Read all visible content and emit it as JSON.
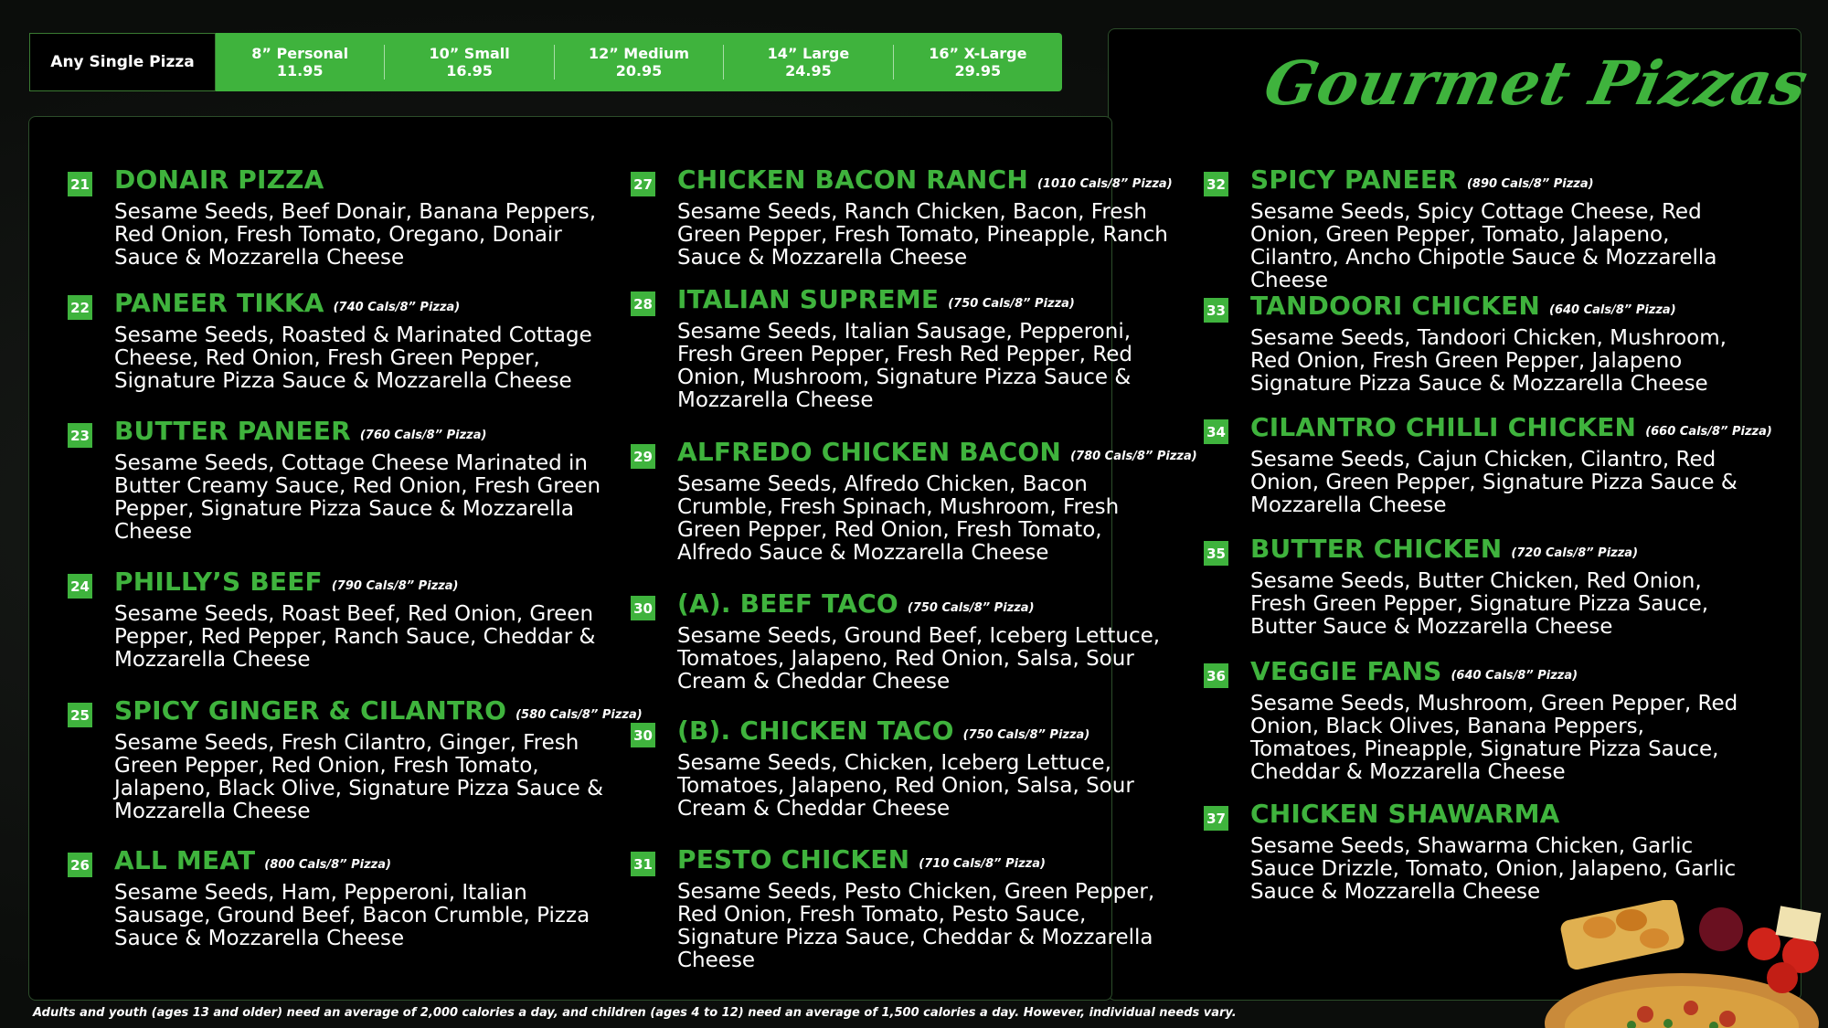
{
  "price_bar": {
    "label": "Any Single Pizza",
    "sizes": [
      {
        "name": "8” Personal",
        "price": "11.95"
      },
      {
        "name": "10” Small",
        "price": "16.95"
      },
      {
        "name": "12” Medium",
        "price": "20.95"
      },
      {
        "name": "14” Large",
        "price": "24.95"
      },
      {
        "name": "16” X-Large",
        "price": "29.95"
      }
    ]
  },
  "title": "Gourmet Pizzas",
  "items": [
    {
      "num": "21",
      "name": "DONAIR PIZZA",
      "cals": "",
      "desc": "Sesame Seeds, Beef Donair, Banana Peppers, Red Onion, Fresh Tomato, Oregano, Donair Sauce & Mozzarella Cheese"
    },
    {
      "num": "22",
      "name": "PANEER TIKKA",
      "cals": "(740 Cals/8” Pizza)",
      "desc": "Sesame Seeds, Roasted & Marinated Cottage Cheese, Red Onion, Fresh Green Pepper, Signature Pizza Sauce & Mozzarella Cheese"
    },
    {
      "num": "23",
      "name": "BUTTER PANEER",
      "cals": "(760 Cals/8” Pizza)",
      "desc": "Sesame Seeds, Cottage Cheese Marinated in Butter Creamy Sauce, Red Onion, Fresh Green Pepper, Signature Pizza Sauce & Mozzarella Cheese"
    },
    {
      "num": "24",
      "name": "PHILLY’S BEEF",
      "cals": "(790 Cals/8” Pizza)",
      "desc": "Sesame Seeds, Roast Beef, Red Onion, Green Pepper, Red Pepper, Ranch Sauce, Cheddar & Mozzarella Cheese"
    },
    {
      "num": "25",
      "name": "SPICY GINGER & CILANTRO",
      "cals": "(580 Cals/8” Pizza)",
      "desc": "Sesame Seeds, Fresh Cilantro, Ginger, Fresh Green Pepper, Red Onion, Fresh Tomato, Jalapeno, Black Olive, Signature Pizza Sauce & Mozzarella Cheese"
    },
    {
      "num": "26",
      "name": "ALL MEAT",
      "cals": "(800 Cals/8” Pizza)",
      "desc": "Sesame Seeds, Ham, Pepperoni, Italian Sausage, Ground Beef, Bacon Crumble, Pizza Sauce & Mozzarella Cheese"
    },
    {
      "num": "27",
      "name": "CHICKEN BACON RANCH",
      "cals": "(1010 Cals/8” Pizza)",
      "desc": "Sesame Seeds, Ranch Chicken, Bacon, Fresh Green Pepper, Fresh Tomato, Pineapple, Ranch Sauce & Mozzarella Cheese"
    },
    {
      "num": "28",
      "name": "ITALIAN SUPREME",
      "cals": "(750 Cals/8” Pizza)",
      "desc": "Sesame Seeds, Italian Sausage, Pepperoni, Fresh Green Pepper, Fresh Red Pepper, Red Onion, Mushroom, Signature Pizza Sauce & Mozzarella Cheese"
    },
    {
      "num": "29",
      "name": "ALFREDO CHICKEN BACON",
      "cals": "(780 Cals/8” Pizza)",
      "desc": "Sesame Seeds, Alfredo Chicken, Bacon Crumble, Fresh Spinach, Mushroom, Fresh Green Pepper, Red Onion, Fresh Tomato, Alfredo Sauce & Mozzarella Cheese"
    },
    {
      "num": "30",
      "name": "(A). BEEF TACO",
      "cals": "(750 Cals/8” Pizza)",
      "desc": "Sesame Seeds, Ground Beef, Iceberg Lettuce, Tomatoes, Jalapeno, Red Onion, Salsa, Sour Cream & Cheddar Cheese"
    },
    {
      "num": "30",
      "name": "(B). CHICKEN TACO",
      "cals": "(750 Cals/8” Pizza)",
      "desc": "Sesame Seeds, Chicken, Iceberg Lettuce, Tomatoes, Jalapeno, Red Onion, Salsa, Sour Cream & Cheddar Cheese"
    },
    {
      "num": "31",
      "name": "PESTO CHICKEN",
      "cals": "(710 Cals/8” Pizza)",
      "desc": "Sesame Seeds, Pesto Chicken, Green Pepper, Red Onion, Fresh Tomato, Pesto Sauce, Signature Pizza Sauce, Cheddar & Mozzarella Cheese"
    },
    {
      "num": "32",
      "name": "SPICY PANEER",
      "cals": "(890 Cals/8” Pizza)",
      "desc": "Sesame Seeds, Spicy Cottage Cheese, Red Onion, Green Pepper, Tomato, Jalapeno, Cilantro, Ancho Chipotle Sauce & Mozzarella Cheese"
    },
    {
      "num": "33",
      "name": "TANDOORI CHICKEN",
      "cals": "(640 Cals/8” Pizza)",
      "desc": "Sesame Seeds, Tandoori Chicken, Mushroom, Red Onion, Fresh Green Pepper, Jalapeno Signature Pizza Sauce & Mozzarella Cheese"
    },
    {
      "num": "34",
      "name": "CILANTRO CHILLI CHICKEN",
      "cals": "(660 Cals/8” Pizza)",
      "desc": "Sesame Seeds, Cajun Chicken, Cilantro, Red Onion, Green Pepper, Signature Pizza Sauce & Mozzarella Cheese"
    },
    {
      "num": "35",
      "name": "BUTTER CHICKEN",
      "cals": "(720 Cals/8” Pizza)",
      "desc": "Sesame Seeds, Butter Chicken, Red Onion, Fresh Green Pepper, Signature Pizza Sauce, Butter Sauce & Mozzarella Cheese"
    },
    {
      "num": "36",
      "name": "VEGGIE FANS",
      "cals": "(640 Cals/8” Pizza)",
      "desc": "Sesame Seeds, Mushroom, Green Pepper, Red Onion, Black Olives, Banana Peppers, Tomatoes, Pineapple, Signature Pizza Sauce, Cheddar & Mozzarella Cheese"
    },
    {
      "num": "37",
      "name": "CHICKEN SHAWARMA",
      "cals": "",
      "desc": "Sesame Seeds, Shawarma Chicken, Garlic Sauce Drizzle, Tomato, Onion, Jalapeno, Garlic Sauce & Mozzarella Cheese"
    }
  ],
  "footnote": "Adults and youth (ages 13 and older) need an average of 2,000 calories a day, and children (ages 4 to 12) need an average of 1,500 calories a day. However, individual needs vary.",
  "colors": {
    "accent": "#3fb33d",
    "background": "#000000"
  }
}
